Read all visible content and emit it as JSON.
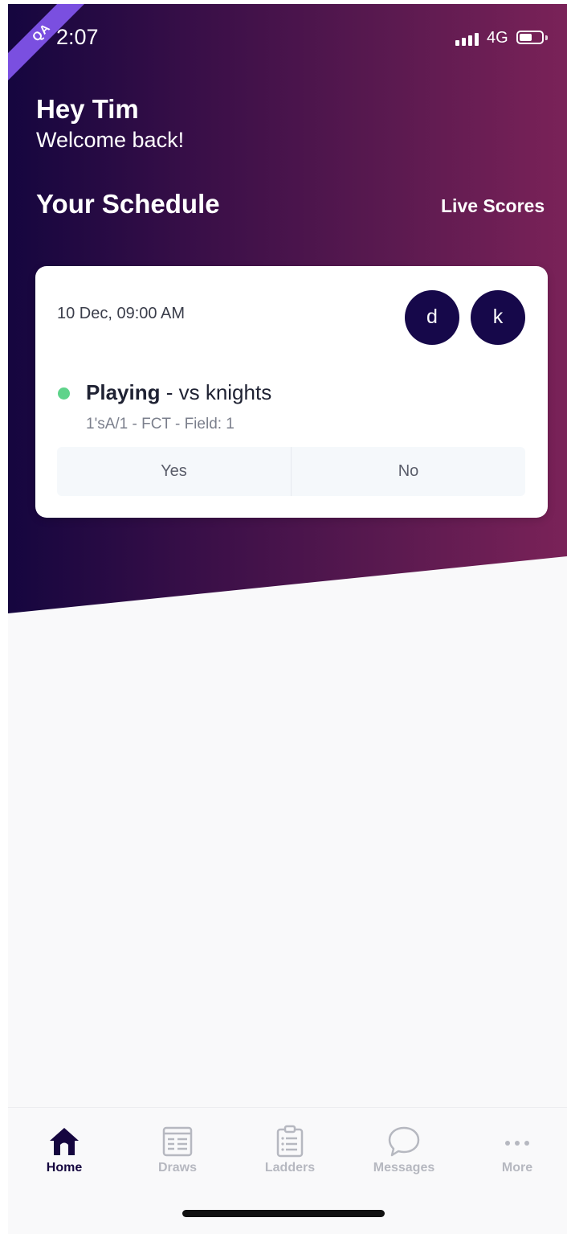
{
  "status_bar": {
    "time": "2:07",
    "network": "4G",
    "env_badge": "QA"
  },
  "header": {
    "greeting": "Hey Tim",
    "subtitle": "Welcome back!"
  },
  "schedule": {
    "title": "Your Schedule",
    "live_scores_label": "Live Scores",
    "card": {
      "date": "10 Dec, 09:00 AM",
      "avatars": [
        "d",
        "k"
      ],
      "status_color": "#5ed38a",
      "status_label": "Playing",
      "opponent": "- vs knights",
      "details": "1'sA/1 - FCT - Field: 1",
      "yes_label": "Yes",
      "no_label": "No"
    }
  },
  "tabbar": {
    "items": [
      {
        "label": "Home",
        "icon": "home-icon",
        "active": true
      },
      {
        "label": "Draws",
        "icon": "draws-icon",
        "active": false
      },
      {
        "label": "Ladders",
        "icon": "ladders-icon",
        "active": false
      },
      {
        "label": "Messages",
        "icon": "messages-icon",
        "active": false
      },
      {
        "label": "More",
        "icon": "more-icon",
        "active": false
      }
    ]
  },
  "colors": {
    "brand_dark": "#15063f",
    "brand_magenta": "#7a2258",
    "qa_ribbon": "#7a4fe0"
  }
}
